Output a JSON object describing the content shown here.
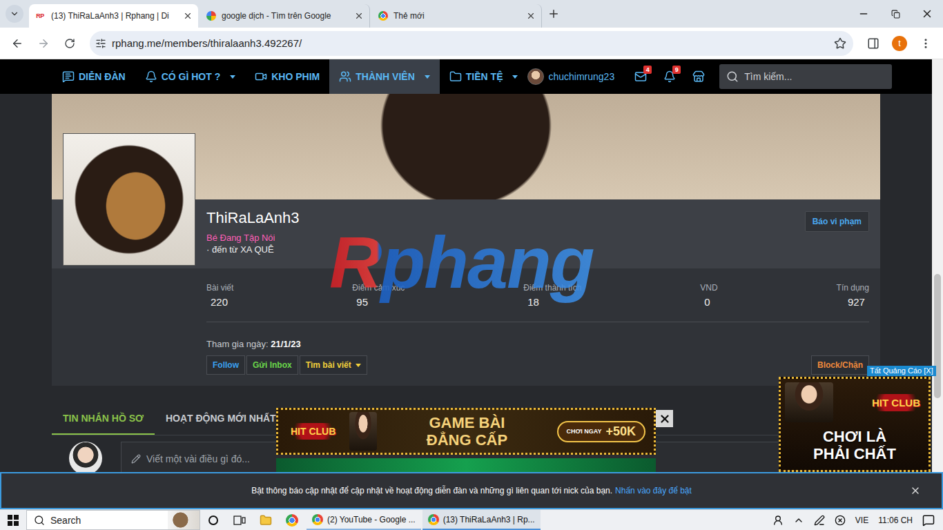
{
  "browser": {
    "tabs": [
      {
        "label": "(13) ThiRaLaAnh3 | Rphang | Di",
        "kind": "site",
        "icon_text": "RP",
        "selected": true
      },
      {
        "label": "google dịch - Tìm trên Google",
        "kind": "google",
        "icon_text": "",
        "selected": false
      },
      {
        "label": "Thẻ mới",
        "kind": "newtab",
        "icon_text": "",
        "selected": false
      }
    ],
    "url": "rphang.me/members/thiralaanh3.492267/",
    "bookmarked": false,
    "profile_initial": "t"
  },
  "nav": {
    "items": [
      {
        "label": "DIỄN ĐÀN",
        "dropdown": false,
        "selected": false
      },
      {
        "label": "CÓ GÌ HOT ?",
        "dropdown": true,
        "selected": false
      },
      {
        "label": "KHO PHIM",
        "dropdown": false,
        "selected": false
      },
      {
        "label": "THÀNH VIÊN",
        "dropdown": true,
        "selected": true
      },
      {
        "label": "TIỀN TỆ",
        "dropdown": true,
        "selected": false
      }
    ],
    "user": "chuchimrung23",
    "inbox_badge": "4",
    "alerts_badge": "9",
    "search_placeholder": "Tìm kiếm..."
  },
  "profile": {
    "name": "ThiRaLaAnh3",
    "rank": "Bé Đang Tập Nói",
    "origin": "· đến từ XA QUÊ",
    "report": "Báo vi phạm",
    "stats": [
      {
        "label": "Bài viết",
        "value": "220"
      },
      {
        "label": "Điểm cảm xúc",
        "value": "95"
      },
      {
        "label": "Điểm thành tích",
        "value": "18"
      },
      {
        "label": "VND",
        "value": "0"
      },
      {
        "label": "Tín dụng",
        "value": "927"
      }
    ],
    "joined_label": "Tham gia ngày:",
    "joined_date": "21/1/23",
    "buttons": [
      {
        "label": "Follow",
        "color": "#3aa0f0",
        "dropdown": false
      },
      {
        "label": "Gửi Inbox",
        "color": "#6ad84a",
        "dropdown": false
      },
      {
        "label": "Tìm bài viết",
        "color": "#f2d03b",
        "dropdown": true
      }
    ],
    "block": "Block/Chặn"
  },
  "watermark": "Rphang",
  "profile_tabs": [
    {
      "label": "TIN NHẮN HỒ SƠ",
      "selected": true
    },
    {
      "label": "HOẠT ĐỘNG MỚI NHẤT",
      "selected": false
    }
  ],
  "post_placeholder": "Viết một vài điều gì đó...",
  "ads": {
    "hide_label": "Tất Quảng Cáo [X]",
    "brand": "HIT CLUB",
    "banner_title": [
      "GAME BÀI",
      "ĐẲNG CẤP"
    ],
    "banner_cta_small": "CHƠI NGAY",
    "banner_cta": "+50K",
    "side_title": [
      "CHƠI LÀ",
      "PHẢI CHẤT"
    ]
  },
  "notice": {
    "text": "Bật thông báo cập nhật để cập nhật về hoạt động diễn đàn và những gì liên quan tới nick của bạn.",
    "link": "Nhấn vào đây để bật"
  },
  "taskbar": {
    "search_placeholder": "Search",
    "windows": [
      {
        "label": "(2) YouTube - Google ...",
        "selected": false
      },
      {
        "label": "(13) ThiRaLaAnh3 | Rp...",
        "selected": true
      }
    ],
    "language": "VIE",
    "time": "11:06 CH"
  }
}
